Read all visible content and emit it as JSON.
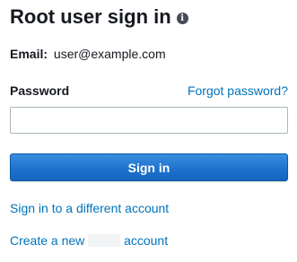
{
  "header": {
    "title": "Root user sign in",
    "info_icon": "info-icon"
  },
  "account": {
    "email_label": "Email:",
    "email_value": "user@example.com"
  },
  "password": {
    "label": "Password",
    "forgot_link": "Forgot password?",
    "value": "",
    "placeholder": ""
  },
  "actions": {
    "signin_label": "Sign in",
    "different_account_link": "Sign in to a different account",
    "create_account_prefix": "Create a new",
    "create_account_suffix": "account"
  },
  "colors": {
    "link": "#0073bb",
    "button": "#1f73cc",
    "text": "#16191f"
  }
}
